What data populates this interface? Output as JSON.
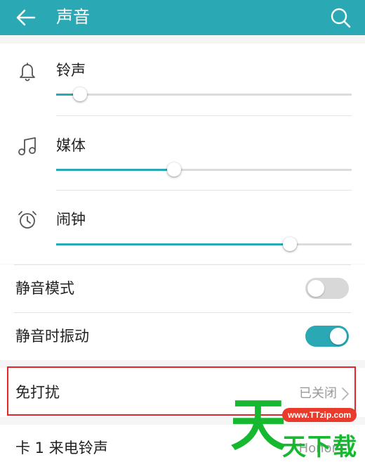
{
  "appbar": {
    "title": "声音",
    "back_icon": "arrow-left-icon",
    "search_icon": "search-icon",
    "color": "#2aa8b4"
  },
  "volume": [
    {
      "label": "铃声",
      "icon": "bell-icon",
      "level_percent": 8
    },
    {
      "label": "媒体",
      "icon": "music-note-icon",
      "level_percent": 40
    },
    {
      "label": "闹钟",
      "icon": "alarm-clock-icon",
      "level_percent": 79
    }
  ],
  "toggles": [
    {
      "label": "静音模式",
      "state": "off"
    },
    {
      "label": "静音时振动",
      "state": "on"
    }
  ],
  "dnd": {
    "label": "免打扰",
    "status": "已关闭",
    "highlight_color": "#e2262b"
  },
  "sim_ringtone": {
    "label": "卡 1 来电铃声",
    "value": "Honor"
  },
  "watermark": {
    "big": "天",
    "pill": "www.TTzip.com",
    "small": "天下载"
  }
}
